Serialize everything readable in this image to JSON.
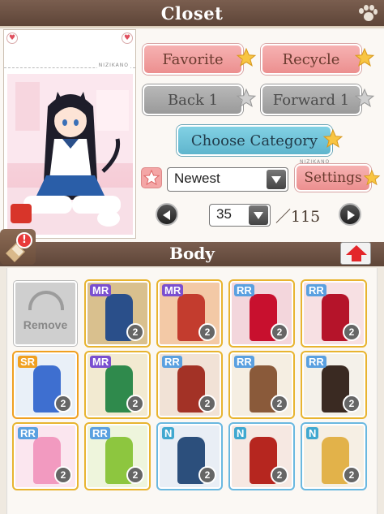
{
  "header": {
    "title": "Closet"
  },
  "portrait": {
    "brand": "NIZIKANO"
  },
  "buttons": {
    "favorite": "Favorite",
    "recycle": "Recycle",
    "back": "Back 1",
    "forward": "Forward 1",
    "choose_category": "Choose Category",
    "settings": "Settings"
  },
  "sort": {
    "selected": "Newest"
  },
  "pagination": {
    "current": "35",
    "total": "／115"
  },
  "category": {
    "title": "Body"
  },
  "grid": {
    "remove_label": "Remove",
    "items": [
      {
        "rank": "MR",
        "count": "2",
        "bg": "#d9c08e",
        "fig": "#2a4f8a"
      },
      {
        "rank": "MR",
        "count": "2",
        "bg": "#f3c9a6",
        "fig": "#c33c2e"
      },
      {
        "rank": "RR",
        "count": "2",
        "bg": "#f3d6dc",
        "fig": "#c8102e"
      },
      {
        "rank": "RR",
        "count": "2",
        "bg": "#f7e0e3",
        "fig": "#b5142a"
      },
      {
        "rank": "SR",
        "count": "2",
        "bg": "#e9f0f8",
        "fig": "#3e6fd0"
      },
      {
        "rank": "MR",
        "count": "2",
        "bg": "#f2ead1",
        "fig": "#2f8a4c"
      },
      {
        "rank": "RR",
        "count": "2",
        "bg": "#f1e2d6",
        "fig": "#a33226"
      },
      {
        "rank": "RR",
        "count": "2",
        "bg": "#f5eee2",
        "fig": "#8a5a3a"
      },
      {
        "rank": "RR",
        "count": "2",
        "bg": "#f4f1ea",
        "fig": "#3a2a22"
      },
      {
        "rank": "RR",
        "count": "2",
        "bg": "#fbe6ef",
        "fig": "#f29ac0"
      },
      {
        "rank": "RR",
        "count": "2",
        "bg": "#eef5dc",
        "fig": "#8dc63f"
      },
      {
        "rank": "N",
        "count": "2",
        "bg": "#e9eef5",
        "fig": "#2c4f7c"
      },
      {
        "rank": "N",
        "count": "2",
        "bg": "#f6e8e2",
        "fig": "#b6261f"
      },
      {
        "rank": "N",
        "count": "2",
        "bg": "#f6efe4",
        "fig": "#e2b24a"
      }
    ]
  }
}
